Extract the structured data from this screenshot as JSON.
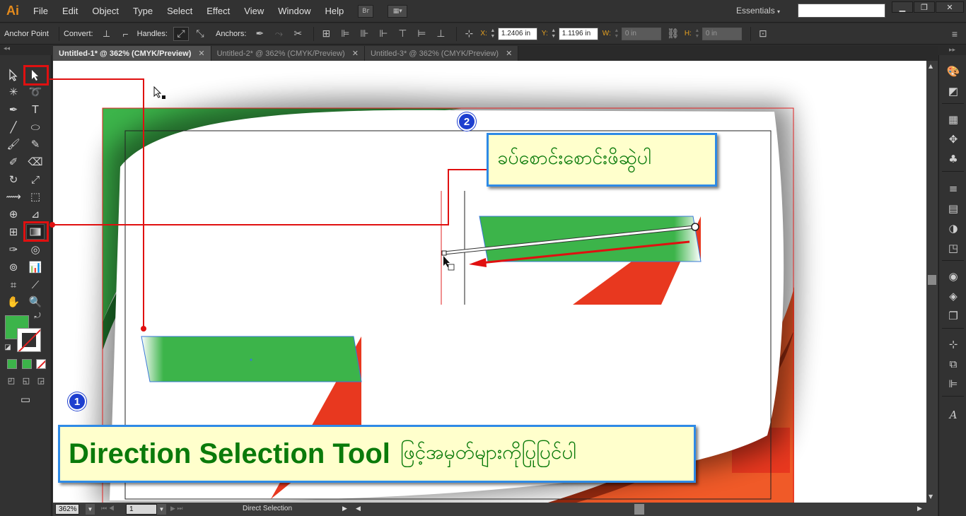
{
  "app": {
    "logo": "Ai"
  },
  "menu": [
    "File",
    "Edit",
    "Object",
    "Type",
    "Select",
    "Effect",
    "View",
    "Window",
    "Help"
  ],
  "menubar_buttons": {
    "bridge": "Br",
    "arrange": "▦▾"
  },
  "workspace": {
    "label": "Essentials",
    "caret": "▾"
  },
  "window_controls": {
    "minimize": "▁",
    "restore": "❐",
    "close": "✕"
  },
  "control_bar": {
    "title": "Anchor Point",
    "convert_label": "Convert:",
    "handles_label": "Handles:",
    "anchors_label": "Anchors:",
    "x_label": "X:",
    "x_value": "1.2406 in",
    "y_label": "Y:",
    "y_value": "1.1196 in",
    "w_label": "W:",
    "w_value": "0 in",
    "h_label": "H:",
    "h_value": "0 in"
  },
  "tabs": [
    {
      "label": "Untitled-1* @ 362% (CMYK/Preview)",
      "active": true
    },
    {
      "label": "Untitled-2* @ 362% (CMYK/Preview)",
      "active": false
    },
    {
      "label": "Untitled-3* @ 362% (CMYK/Preview)",
      "active": false
    }
  ],
  "tab_close": "✕",
  "status": {
    "zoom": "362%",
    "page": "1",
    "tool": "Direct Selection"
  },
  "annotations": {
    "badge1": "1",
    "badge2": "2",
    "callout1_title": "Direction Selection Tool",
    "callout1_text": "ဖြင့်အမှတ်များကိုပြုပြင်ပါ",
    "callout2_text": "ခပ်စောင်းစောင်းဖိဆွဲပါ"
  },
  "colors": {
    "fill": "#3cb44a",
    "accent_red": "#e8381f",
    "callout_border": "#2e8ae6",
    "callout_bg": "#ffffcc",
    "callout_text": "#0a7a0a"
  }
}
